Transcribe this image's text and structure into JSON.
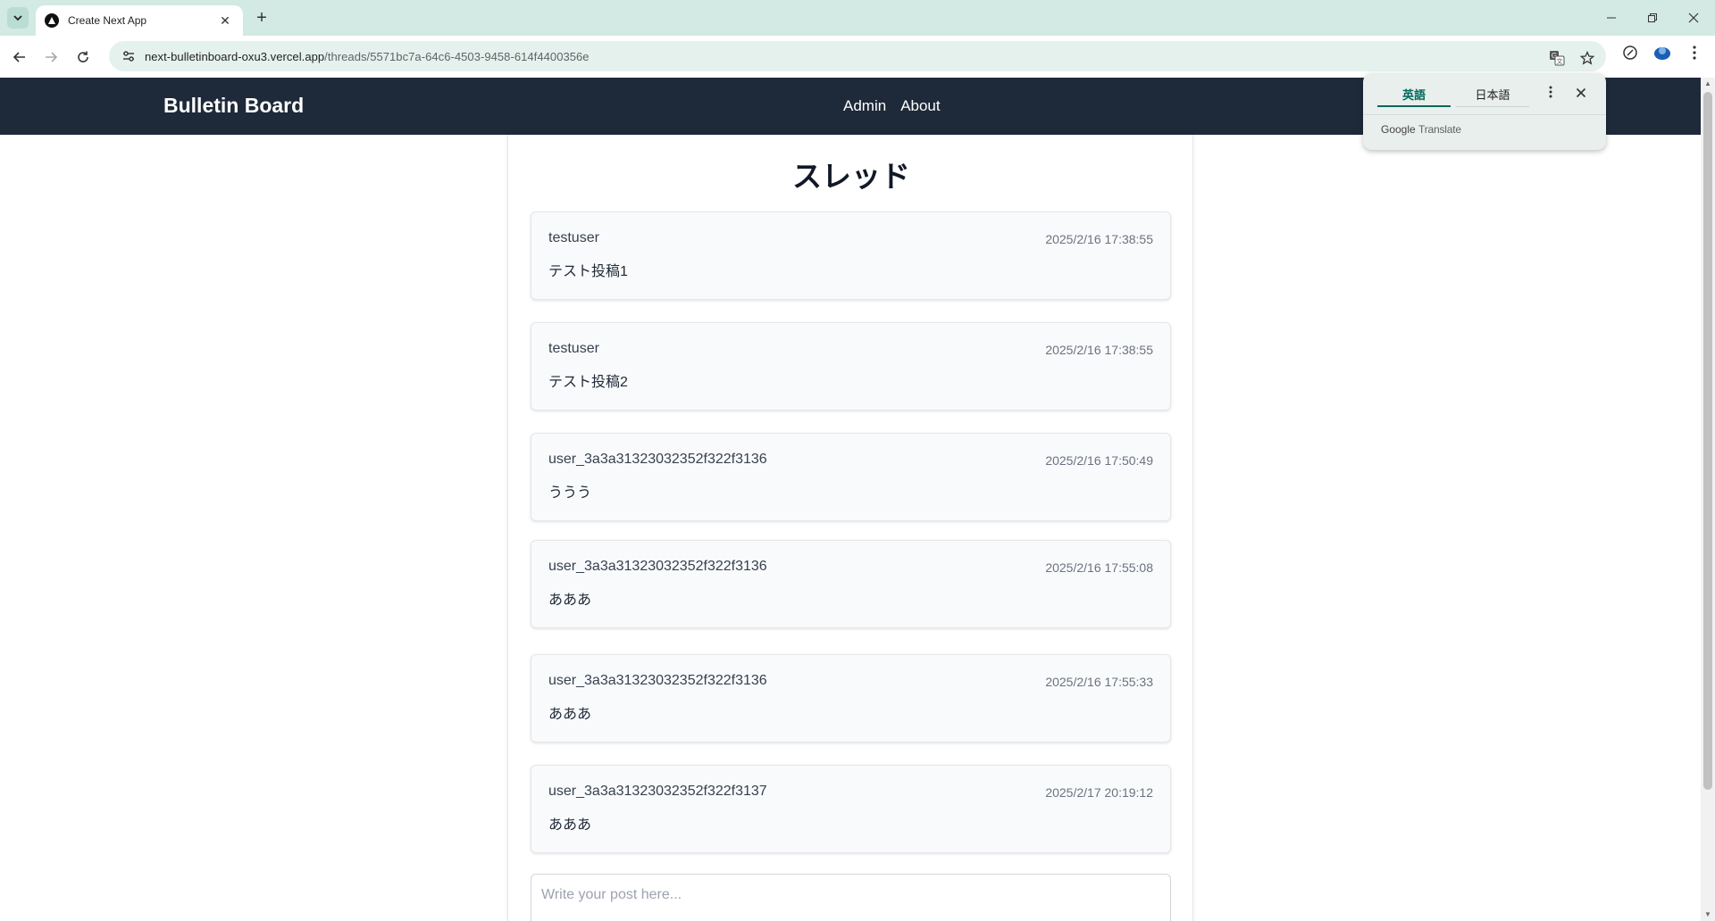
{
  "browser": {
    "tab_title": "Create Next App",
    "url_host": "next-bulletinboard-oxu3.vercel.app",
    "url_path": "/threads/5571bc7a-64c6-4503-9458-614f4400356e",
    "new_tab_label": "+",
    "tab_close_label": "✕"
  },
  "header": {
    "brand": "Bulletin Board",
    "nav": [
      "Admin",
      "About"
    ]
  },
  "thread": {
    "title": "スレッド",
    "posts": [
      {
        "author": "testuser",
        "time": "2025/2/16 17:38:55",
        "body": "テスト投稿1"
      },
      {
        "author": "testuser",
        "time": "2025/2/16 17:38:55",
        "body": "テスト投稿2"
      },
      {
        "author": "user_3a3a31323032352f322f3136",
        "time": "2025/2/16 17:50:49",
        "body": "ううう"
      },
      {
        "author": "user_3a3a31323032352f322f3136",
        "time": "2025/2/16 17:55:08",
        "body": "あああ"
      },
      {
        "author": "user_3a3a31323032352f322f3136",
        "time": "2025/2/16 17:55:33",
        "body": "あああ"
      },
      {
        "author": "user_3a3a31323032352f322f3137",
        "time": "2025/2/17 20:19:12",
        "body": "あああ"
      }
    ],
    "compose_placeholder": "Write your post here..."
  },
  "translate": {
    "languages": [
      "英語",
      "日本語"
    ],
    "active_language": "英語",
    "brand_google": "Google",
    "brand_translate": "Translate"
  },
  "colors": {
    "header_bg": "#1e2939",
    "accent_teal": "#00695c",
    "chrome_bg": "#d3e9e3"
  }
}
